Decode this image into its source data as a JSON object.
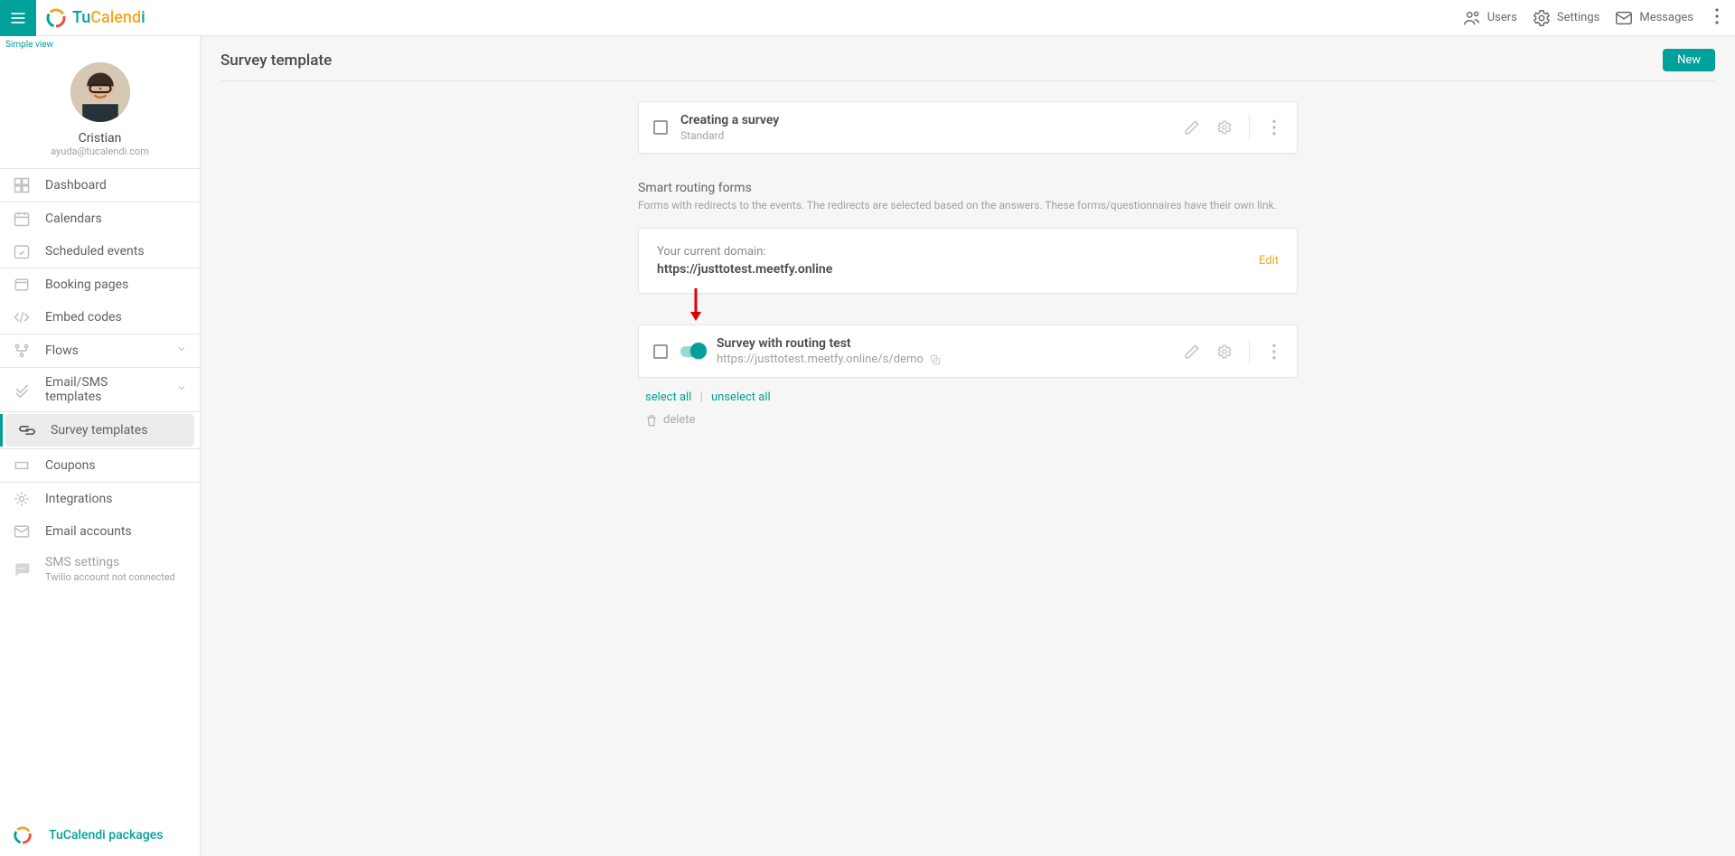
{
  "brand": {
    "part1": "Tu",
    "part2": "Calend",
    "part3": "i"
  },
  "topbar": {
    "users": "Users",
    "settings": "Settings",
    "messages": "Messages"
  },
  "sidebar": {
    "simple_view": "Simple view",
    "profile": {
      "name": "Cristian",
      "email": "ayuda@tucalendi.com"
    },
    "nav": {
      "dashboard": "Dashboard",
      "calendars": "Calendars",
      "scheduled": "Scheduled events",
      "booking": "Booking pages",
      "embed": "Embed codes",
      "flows": "Flows",
      "email_sms": "Email/SMS templates",
      "survey": "Survey templates",
      "coupons": "Coupons",
      "integrations": "Integrations",
      "email_accounts": "Email accounts",
      "sms_settings": "SMS settings",
      "sms_sub": "Twilio account not connected"
    },
    "footer": "TuCalendi packages"
  },
  "page": {
    "title": "Survey template",
    "new_btn": "New",
    "list": [
      {
        "title": "Creating a survey",
        "sub": "Standard"
      }
    ],
    "routing": {
      "heading": "Smart routing forms",
      "desc": "Forms with redirects to the events. The redirects are selected based on the answers. These forms/questionnaires have their own link.",
      "domain_label": "Your current domain:",
      "domain_value": "https://justtotest.meetfy.online",
      "edit": "Edit",
      "item": {
        "title": "Survey with routing test",
        "url": "https://justtotest.meetfy.online/s/demo",
        "enabled": true
      }
    },
    "select_all": "select all",
    "unselect_all": "unselect all",
    "delete": "delete"
  }
}
